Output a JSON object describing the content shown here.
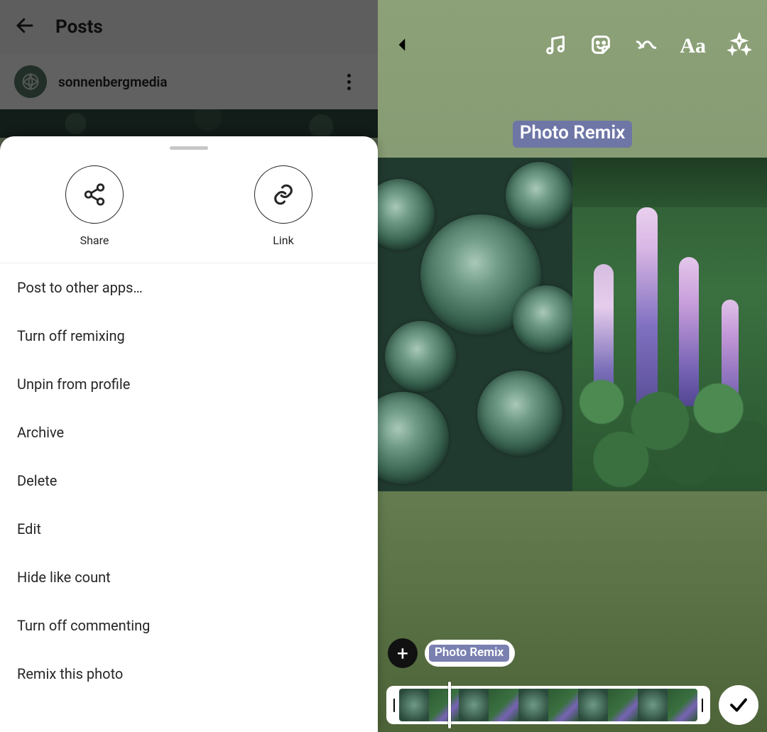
{
  "left": {
    "header_title": "Posts",
    "username": "sonnenbergmedia",
    "sheet": {
      "share_label": "Share",
      "link_label": "Link",
      "menu": [
        "Post to other apps…",
        "Turn off remixing",
        "Unpin from profile",
        "Archive",
        "Delete",
        "Edit",
        "Hide like count",
        "Turn off commenting",
        "Remix this photo"
      ]
    }
  },
  "right": {
    "tag_label": "Photo Remix",
    "chip_label": "Photo Remix",
    "add_symbol": "+",
    "tl_left_handle": "|",
    "tl_right_handle": "|"
  }
}
